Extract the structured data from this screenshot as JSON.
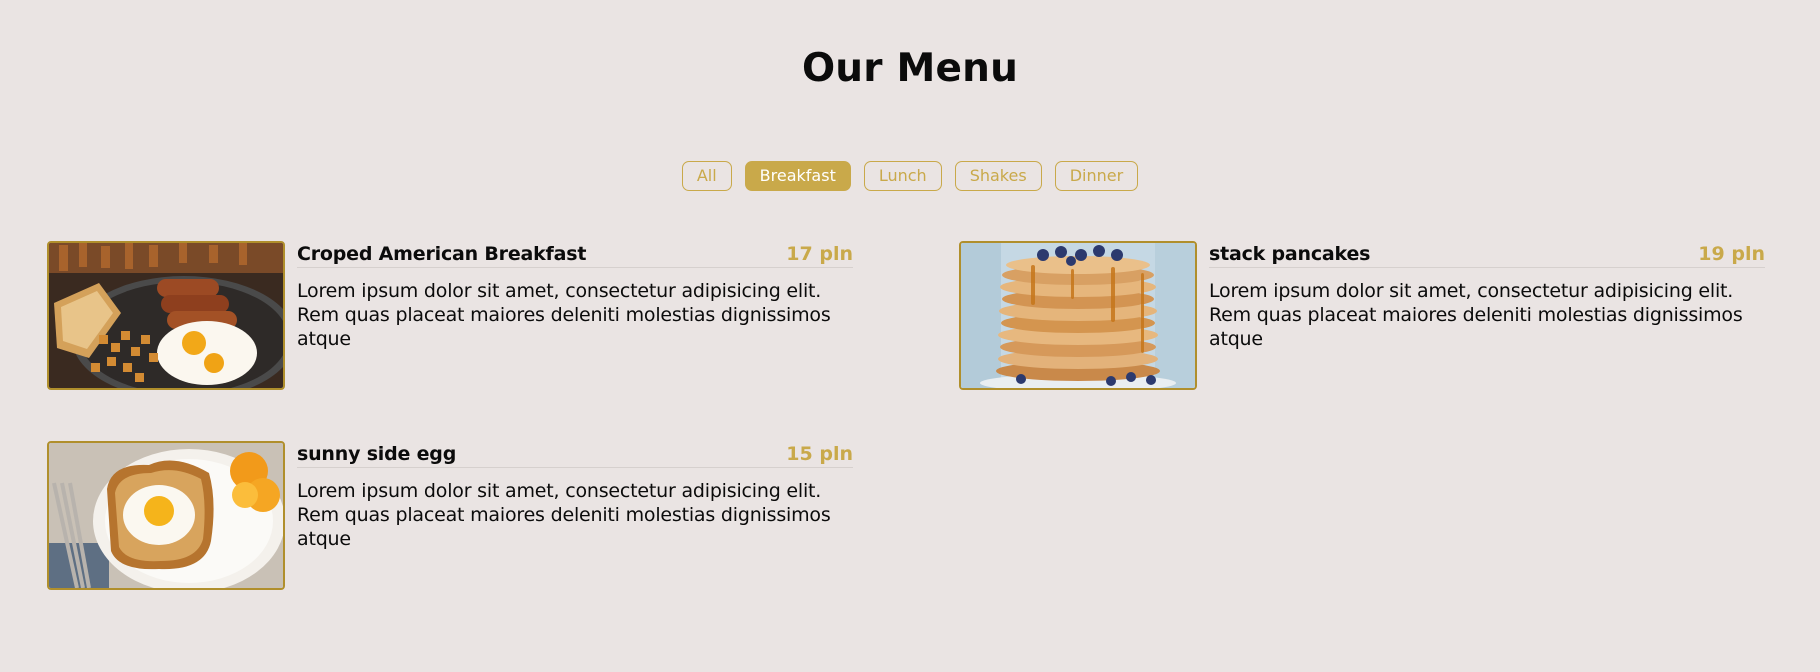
{
  "title": "Our Menu",
  "filters": [
    {
      "label": "All",
      "active": false
    },
    {
      "label": "Breakfast",
      "active": true
    },
    {
      "label": "Lunch",
      "active": false
    },
    {
      "label": "Shakes",
      "active": false
    },
    {
      "label": "Dinner",
      "active": false
    }
  ],
  "items": [
    {
      "name": "Croped American Breakfast",
      "price": "17 pln",
      "desc": "Lorem ipsum dolor sit amet, consectetur adipisicing elit. Rem quas placeat maiores deleniti molestias dignissimos atque",
      "image": "american-breakfast-photo"
    },
    {
      "name": "stack pancakes",
      "price": "19 pln",
      "desc": "Lorem ipsum dolor sit amet, consectetur adipisicing elit. Rem quas placeat maiores deleniti molestias dignissimos atque",
      "image": "pancake-stack-photo"
    },
    {
      "name": "sunny side egg",
      "price": "15 pln",
      "desc": "Lorem ipsum dolor sit amet, consectetur adipisicing elit. Rem quas placeat maiores deleniti molestias dignissimos atque",
      "image": "egg-toast-photo"
    }
  ],
  "colors": {
    "background": "#eae4e3",
    "accent": "#c9a94a",
    "photo_border": "#b08f2c",
    "text": "#0b0b0b"
  }
}
